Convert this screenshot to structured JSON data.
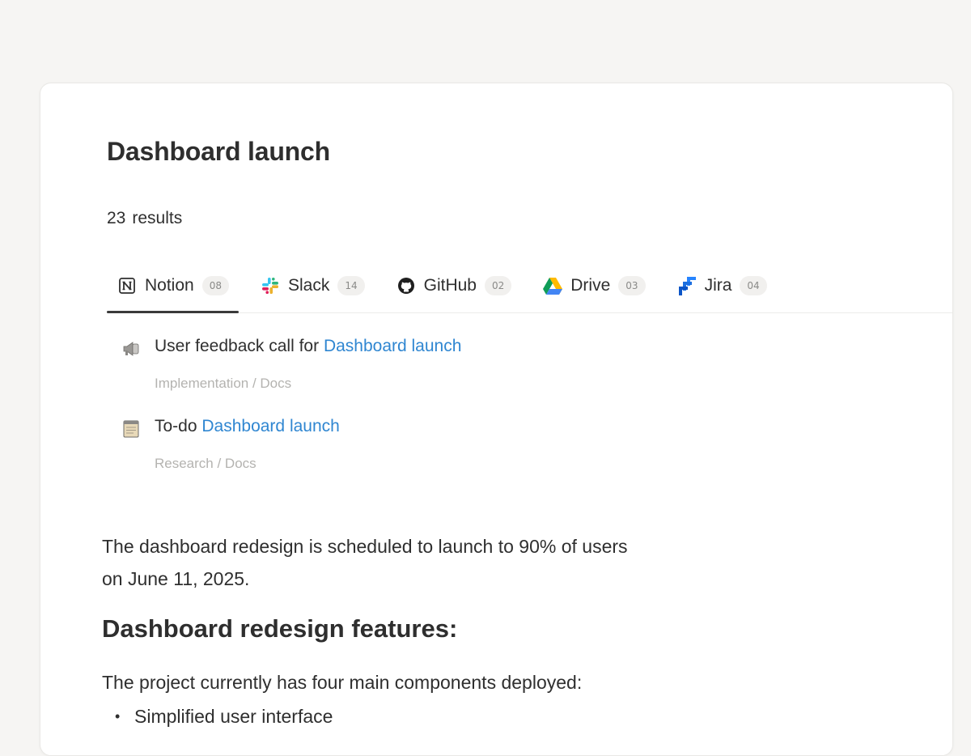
{
  "panel": {
    "title": "Dashboard launch",
    "results_count": "23",
    "results_label": "results"
  },
  "tabs": [
    {
      "label": "Notion",
      "count": "08",
      "icon": "notion-icon",
      "active": true
    },
    {
      "label": "Slack",
      "count": "14",
      "icon": "slack-icon",
      "active": false
    },
    {
      "label": "GitHub",
      "count": "02",
      "icon": "github-icon",
      "active": false
    },
    {
      "label": "Drive",
      "count": "03",
      "icon": "drive-icon",
      "active": false
    },
    {
      "label": "Jira",
      "count": "04",
      "icon": "jira-icon",
      "active": false
    }
  ],
  "results": [
    {
      "icon": "megaphone-icon",
      "prefix": "User feedback call for ",
      "match": "Dashboard launch",
      "path": "Implementation / Docs"
    },
    {
      "icon": "notepad-icon",
      "prefix": "To-do ",
      "match": "Dashboard launch",
      "path": "Research / Docs"
    }
  ],
  "document": {
    "paragraph1_line1": "The dashboard redesign is scheduled to launch to 90% of users",
    "paragraph1_line2": "on June 11, 2025.",
    "heading": "Dashboard redesign features:",
    "paragraph2": "The project currently has four main components deployed:",
    "bullets": [
      "Simplified user interface"
    ]
  },
  "colors": {
    "background": "#f6f5f3",
    "highlight": "#2f86d1",
    "muted_text": "#b4b3b0"
  }
}
